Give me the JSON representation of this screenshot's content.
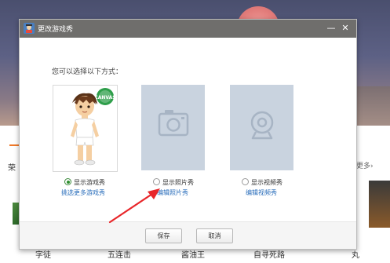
{
  "background": {
    "left_label": "荣",
    "right_more": "更多›",
    "bottom_items": [
      "字徒",
      "五连击",
      "酱油王",
      "自寻死路",
      "丸"
    ]
  },
  "dialog": {
    "title": "更改游戏秀",
    "prompt": "您可以选择以下方式：",
    "options": [
      {
        "label": "显示游戏秀",
        "link": "挑选更多游戏秀",
        "selected": true,
        "badge": "CANVAS",
        "icon": "avatar-figure"
      },
      {
        "label": "显示照片秀",
        "link": "编辑照片秀",
        "selected": false,
        "icon": "camera-icon"
      },
      {
        "label": "显示视频秀",
        "link": "编辑视频秀",
        "selected": false,
        "icon": "webcam-icon"
      }
    ],
    "buttons": {
      "save": "保存",
      "cancel": "取消"
    },
    "window_controls": {
      "minimize": "—",
      "close": "✕"
    }
  },
  "colors": {
    "titlebar": "#6f6e6c",
    "link": "#2a6ebb",
    "placeholder_bg": "#c9d3df",
    "annotation_arrow": "#e8262a"
  }
}
